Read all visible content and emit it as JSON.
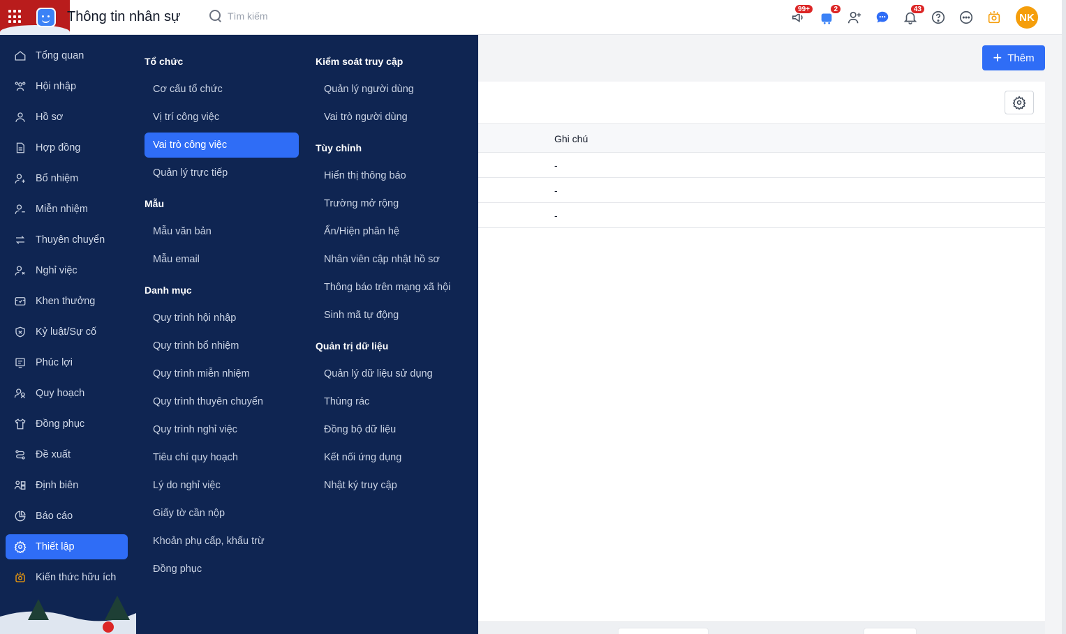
{
  "header": {
    "title": "Thông tin nhân sự",
    "search_placeholder": "Tìm kiếm",
    "badges": {
      "announcements": "99+",
      "cart": "2",
      "notifications": "43"
    },
    "avatar_initials": "NK"
  },
  "sidebar": {
    "items": [
      {
        "label": "Tổng quan",
        "icon": "home-icon"
      },
      {
        "label": "Hội nhập",
        "icon": "users-icon"
      },
      {
        "label": "Hồ sơ",
        "icon": "user-icon"
      },
      {
        "label": "Hợp đồng",
        "icon": "document-icon"
      },
      {
        "label": "Bổ nhiệm",
        "icon": "user-plus-icon"
      },
      {
        "label": "Miễn nhiệm",
        "icon": "user-minus-icon"
      },
      {
        "label": "Thuyên chuyển",
        "icon": "transfer-icon"
      },
      {
        "label": "Nghỉ việc",
        "icon": "user-x-icon"
      },
      {
        "label": "Khen thưởng",
        "icon": "award-icon"
      },
      {
        "label": "Kỷ luật/Sự cố",
        "icon": "shield-icon"
      },
      {
        "label": "Phúc lợi",
        "icon": "gift-icon"
      },
      {
        "label": "Quy hoạch",
        "icon": "planning-icon"
      },
      {
        "label": "Đồng phục",
        "icon": "shirt-icon"
      },
      {
        "label": "Đề xuất",
        "icon": "proposal-icon"
      },
      {
        "label": "Định biên",
        "icon": "headcount-icon"
      },
      {
        "label": "Báo cáo",
        "icon": "chart-pie-icon"
      },
      {
        "label": "Thiết lập",
        "icon": "gear-icon",
        "active": true
      },
      {
        "label": "Kiến thức hữu ích",
        "icon": "lightbulb-icon"
      }
    ]
  },
  "mega_menu": {
    "col1": {
      "to_chuc": {
        "title": "Tổ chức",
        "items": [
          "Cơ cấu tổ chức",
          "Vị trí công việc",
          "Vai trò công việc",
          "Quản lý trực tiếp"
        ]
      },
      "mau": {
        "title": "Mẫu",
        "items": [
          "Mẫu văn bản",
          "Mẫu email"
        ]
      },
      "danh_muc": {
        "title": "Danh mục",
        "items": [
          "Quy trình hội nhập",
          "Quy trình bổ nhiệm",
          "Quy trình miễn nhiệm",
          "Quy trình thuyên chuyển",
          "Quy trình nghỉ việc",
          "Tiêu chí quy hoạch",
          "Lý do nghỉ việc",
          "Giấy tờ cần nộp",
          "Khoản phụ cấp, khấu trừ",
          "Đồng phục"
        ]
      }
    },
    "col2": {
      "kiem_soat": {
        "title": "Kiểm soát truy cập",
        "items": [
          "Quản lý người dùng",
          "Vai trò người dùng"
        ]
      },
      "tuy_chinh": {
        "title": "Tùy chỉnh",
        "items": [
          "Hiển thị thông báo",
          "Trường mở rộng",
          "Ẩn/Hiện phân hệ",
          "Nhân viên cập nhật hồ sơ",
          "Thông báo trên mạng xã hội",
          "Sinh mã tự động"
        ]
      },
      "quan_tri": {
        "title": "Quản trị dữ liệu",
        "items": [
          "Quản lý dữ liệu sử dụng",
          "Thùng rác",
          "Đồng bộ dữ liệu",
          "Kết nối ứng dụng",
          "Nhật ký truy cập"
        ]
      }
    },
    "active_item": "Vai trò công việc"
  },
  "content": {
    "add_button_label": "Thêm",
    "table": {
      "header_note": "Ghi chú",
      "rows": [
        {
          "note": "-"
        },
        {
          "note": "-"
        },
        {
          "note": "-"
        }
      ]
    }
  },
  "colors": {
    "sidebar_bg": "#0f2552",
    "accent": "#2f6df6",
    "badge": "#dc2626",
    "avatar": "#f59e0b"
  }
}
